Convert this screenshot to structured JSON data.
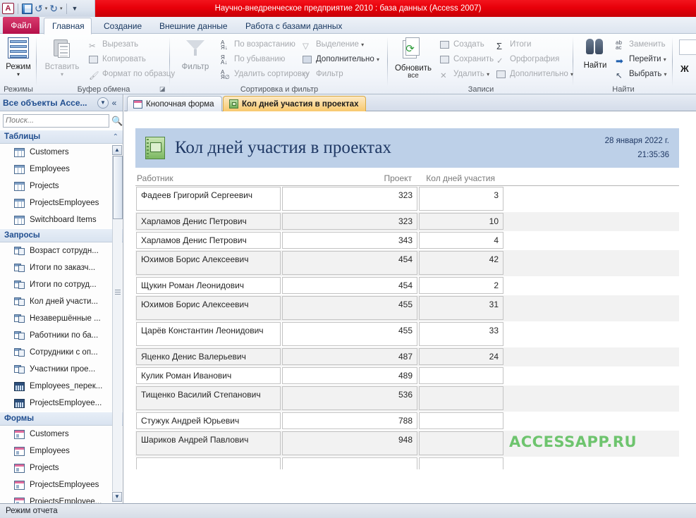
{
  "window": {
    "title": "Научно-внедренческое предприятие 2010 : база данных (Access 2007)",
    "qat": {
      "logo": "A",
      "save": "save-icon",
      "undo": "↺",
      "redo": "↻",
      "customize": "▾"
    }
  },
  "ribbon": {
    "tabs": [
      {
        "label": "Файл",
        "active": false
      },
      {
        "label": "Главная",
        "active": true
      },
      {
        "label": "Создание",
        "active": false
      },
      {
        "label": "Внешние данные",
        "active": false
      },
      {
        "label": "Работа с базами данных",
        "active": false
      }
    ],
    "groups": [
      {
        "label": "Режимы",
        "big": [
          {
            "label": "Режим",
            "dropdown": "▾",
            "icon": "view-icon"
          }
        ],
        "small": []
      },
      {
        "label": "Буфер обмена",
        "big": [
          {
            "label": "Вставить",
            "dropdown": "▾",
            "icon": "paste-icon"
          }
        ],
        "small": [
          {
            "label": "Вырезать",
            "icon": "cut-icon",
            "disabled": true
          },
          {
            "label": "Копировать",
            "icon": "copy-icon",
            "disabled": true
          },
          {
            "label": "Формат по образцу",
            "icon": "format-painter-icon",
            "disabled": true
          }
        ]
      },
      {
        "label": "Сортировка и фильтр",
        "big": [
          {
            "label": "Фильтр",
            "dropdown": "",
            "icon": "filter-icon"
          }
        ],
        "small": [
          {
            "label": "По возрастанию",
            "icon": "sort-asc-icon",
            "disabled": true
          },
          {
            "label": "По убыванию",
            "icon": "sort-desc-icon",
            "disabled": true
          },
          {
            "label": "Удалить сортировку",
            "icon": "clear-sort-icon",
            "disabled": true
          },
          {
            "label": "Выделение",
            "icon": "selection-icon",
            "disabled": true,
            "dropdown": "▾"
          },
          {
            "label": "Дополнительно",
            "icon": "advanced-filter-icon",
            "disabled": false,
            "dropdown": "▾"
          },
          {
            "label": "Фильтр",
            "icon": "toggle-filter-icon",
            "disabled": true
          }
        ]
      },
      {
        "label": "Записи",
        "big": [
          {
            "label": "Обновить",
            "label2": "все",
            "dropdown": "▾",
            "icon": "refresh-all-icon"
          }
        ],
        "small": [
          {
            "label": "Создать",
            "icon": "new-record-icon",
            "disabled": true
          },
          {
            "label": "Сохранить",
            "icon": "save-record-icon",
            "disabled": true
          },
          {
            "label": "Удалить",
            "icon": "delete-record-icon",
            "disabled": true,
            "dropdown": "▾"
          },
          {
            "label": "Итоги",
            "icon": "totals-icon",
            "disabled": true
          },
          {
            "label": "Орфография",
            "icon": "spelling-icon",
            "disabled": true
          },
          {
            "label": "Дополнительно",
            "icon": "more-records-icon",
            "disabled": true,
            "dropdown": "▾"
          }
        ]
      },
      {
        "label": "Найти",
        "big": [
          {
            "label": "Найти",
            "dropdown": "",
            "icon": "binoculars-icon"
          }
        ],
        "small": [
          {
            "label": "Заменить",
            "icon": "replace-icon",
            "disabled": true
          },
          {
            "label": "Перейти",
            "icon": "goto-icon",
            "disabled": false,
            "dropdown": "▾"
          },
          {
            "label": "Выбрать",
            "icon": "select-icon",
            "disabled": false,
            "dropdown": "▾"
          }
        ]
      },
      {
        "label": "",
        "big": [],
        "small": [
          {
            "label": "Ж",
            "icon": "bold-icon",
            "disabled": false
          }
        ]
      }
    ]
  },
  "nav": {
    "header": "Все объекты Acce...",
    "dropdown_icon": "chevron-down-icon",
    "collapse_icon": "double-chevron-left-icon",
    "search_placeholder": "Поиск...",
    "search_value": "",
    "search_icon": "search-icon",
    "groups": [
      {
        "title": "Таблицы",
        "items": [
          {
            "label": "Customers",
            "icon": "table-icon"
          },
          {
            "label": "Employees",
            "icon": "table-icon"
          },
          {
            "label": "Projects",
            "icon": "table-icon"
          },
          {
            "label": "ProjectsEmployees",
            "icon": "table-icon"
          },
          {
            "label": "Switchboard Items",
            "icon": "table-icon"
          }
        ]
      },
      {
        "title": "Запросы",
        "items": [
          {
            "label": "Возраст сотрудн...",
            "icon": "query-icon"
          },
          {
            "label": "Итоги по заказч...",
            "icon": "query-icon"
          },
          {
            "label": "Итоги по сотруд...",
            "icon": "query-icon"
          },
          {
            "label": "Кол дней участи...",
            "icon": "query-icon"
          },
          {
            "label": "Незавершённые ...",
            "icon": "query-icon"
          },
          {
            "label": "Работники по ба...",
            "icon": "query-icon"
          },
          {
            "label": "Сотрудники с оп...",
            "icon": "query-icon"
          },
          {
            "label": "Участники прое...",
            "icon": "query-icon"
          },
          {
            "label": "Employees_перек...",
            "icon": "crosstab-icon"
          },
          {
            "label": "ProjectsEmployee...",
            "icon": "crosstab-icon"
          }
        ]
      },
      {
        "title": "Формы",
        "items": [
          {
            "label": "Customers",
            "icon": "form-icon"
          },
          {
            "label": "Employees",
            "icon": "form-icon"
          },
          {
            "label": "Projects",
            "icon": "form-icon"
          },
          {
            "label": "ProjectsEmployees",
            "icon": "form-icon"
          },
          {
            "label": "ProjectsEmployee...",
            "icon": "form-icon"
          }
        ]
      }
    ]
  },
  "doc_tabs": [
    {
      "label": "Кнопочная форма",
      "icon": "form-icon",
      "active": false
    },
    {
      "label": "Кол дней участия в проектах",
      "icon": "report-icon",
      "active": true
    }
  ],
  "report": {
    "title": "Кол дней участия в проектах",
    "title_icon": "report-book-icon",
    "date": "28 января 2022 г.",
    "time": "21:35:36",
    "columns": {
      "name": "Работник",
      "project": "Проект",
      "days": "Кол дней участия"
    },
    "watermark": "ACCESSAPP.RU",
    "rows": [
      {
        "name": "Фадеев Григорий Сергеевич",
        "project": "323",
        "days": "3",
        "tall": true,
        "alt": false
      },
      {
        "name": "Харламов Денис Петрович",
        "project": "323",
        "days": "10",
        "tall": false,
        "alt": true
      },
      {
        "name": "Харламов Денис Петрович",
        "project": "343",
        "days": "4",
        "tall": false,
        "alt": false
      },
      {
        "name": "Юхимов Борис Алексеевич",
        "project": "454",
        "days": "42",
        "tall": true,
        "alt": true
      },
      {
        "name": "Щукин Роман Леонидович",
        "project": "454",
        "days": "2",
        "tall": false,
        "alt": false
      },
      {
        "name": "Юхимов Борис Алексеевич",
        "project": "455",
        "days": "31",
        "tall": true,
        "alt": true
      },
      {
        "name": "Царёв Константин Леонидович",
        "project": "455",
        "days": "33",
        "tall": true,
        "alt": false
      },
      {
        "name": "Яценко Денис Валерьевич",
        "project": "487",
        "days": "24",
        "tall": false,
        "alt": true
      },
      {
        "name": "Кулик Роман Иванович",
        "project": "489",
        "days": "",
        "tall": false,
        "alt": false
      },
      {
        "name": "Тищенко Василий Степанович",
        "project": "536",
        "days": "",
        "tall": true,
        "alt": true
      },
      {
        "name": "Стужук Андрей Юрьевич",
        "project": "788",
        "days": "",
        "tall": false,
        "alt": false
      },
      {
        "name": "Шариков Андрей Павлович",
        "project": "948",
        "days": "",
        "tall": true,
        "alt": true
      },
      {
        "name": "",
        "project": "",
        "days": "",
        "tall": false,
        "alt": false
      }
    ]
  },
  "status": {
    "mode": "Режим отчета"
  },
  "colors": {
    "title_bar": "#e8000a",
    "accent_tab": "#f8c96e",
    "report_header": "#bdd0e8",
    "report_title": "#1f3864",
    "watermark": "#63c163"
  }
}
